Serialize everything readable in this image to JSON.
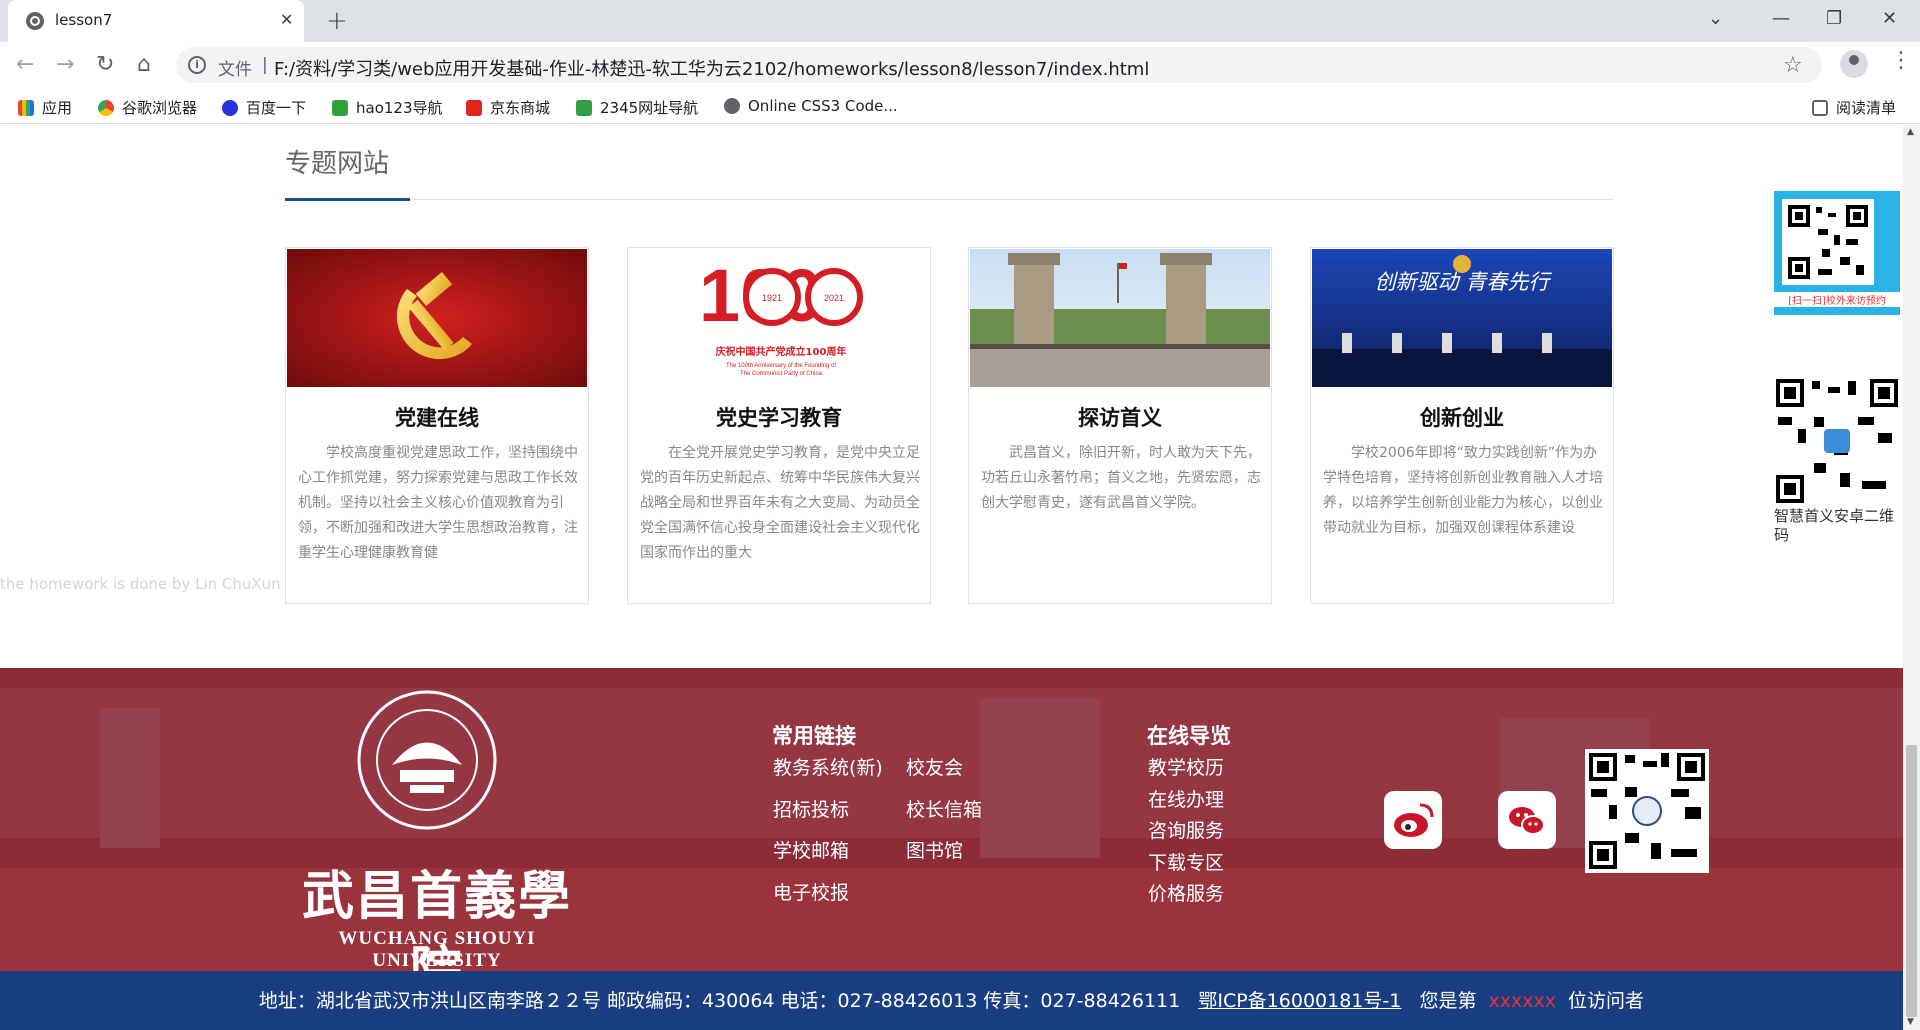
{
  "browser": {
    "tab_title": "lesson7",
    "address_prefix": "文件",
    "address_url": "F:/资料/学习类/web应用开发基础-作业-林楚迅-软工华为云2102/homeworks/lesson8/lesson7/index.html",
    "bookmarks": [
      {
        "label": "应用",
        "icon": "apps-grid-icon",
        "color": "#1a73e8"
      },
      {
        "label": "谷歌浏览器",
        "icon": "chrome-icon",
        "color": "#ea4335"
      },
      {
        "label": "百度一下",
        "icon": "baidu-paw-icon",
        "color": "#2932e1"
      },
      {
        "label": "hao123导航",
        "icon": "hao123-icon",
        "color": "#31a13a"
      },
      {
        "label": "京东商城",
        "icon": "jd-icon",
        "color": "#e1251b"
      },
      {
        "label": "2345网址导航",
        "icon": "2345-icon",
        "color": "#2f9e44"
      },
      {
        "label": "Online CSS3 Code...",
        "icon": "globe-icon",
        "color": "#5f6368"
      }
    ],
    "reading_list": "阅读清单"
  },
  "section": {
    "title": "专题网站"
  },
  "cards": [
    {
      "title": "党建在线",
      "text": "学校高度重视党建思政工作，坚持围绕中心工作抓党建，努力探索党建与思政工作长效机制。坚持以社会主义核心价值观教育为引领，不断加强和改进大学生思想政治教育，注重学生心理健康教育健",
      "image": "party-emblem-image"
    },
    {
      "title": "党史学习教育",
      "text": "在全党开展党史学习教育，是党中央立足党的百年历史新起点、统筹中华民族伟大复兴战略全局和世界百年未有之大变局、为动员全党全国满怀信心投身全面建设社会主义现代化国家而作出的重大",
      "image": "centenary-logo-image",
      "image_caption_cn": "庆祝中国共产党成立100周年",
      "image_caption_en1": "The 100th Anniversary of the Founding of",
      "image_caption_en2": "The Communist Party of China",
      "image_number": "100",
      "image_year_a": "1921",
      "image_year_b": "2021"
    },
    {
      "title": "探访首义",
      "text": "武昌首义，除旧开新，时人敢为天下先，功若丘山永著竹帛；首义之地，先贤宏愿，志创大学慰青史，遂有武昌首义学院。",
      "image": "campus-gate-photo"
    },
    {
      "title": "创新创业",
      "text": "学校2006年即将“致力实践创新”作为办学特色培育，坚持将创新创业教育融入人才培养，以培养学生创新创业能力为核心，以创业带动就业为目标，加强双创课程体系建设",
      "image": "innovation-forum-photo",
      "image_banner": "创新驱动 青春先行"
    }
  ],
  "homework_note": "the homework is done by Lin ChuXun",
  "side_qr": {
    "caption1": "[扫一扫]校外来访预约",
    "caption2": "智慧首义安卓二维码"
  },
  "footer": {
    "university_cn": "武昌首義學院",
    "university_en": "WUCHANG SHOUYI UNIVERSITY",
    "seal_text": "WUCHANG SHOUYI UNIVERSITY",
    "links_heading": "常用链接",
    "links": [
      "教务系统(新)",
      "校友会",
      "招标投标",
      "校长信箱",
      "学校邮箱",
      "图书馆",
      "电子校报"
    ],
    "nav_heading": "在线导览",
    "nav": [
      "教学校历",
      "在线办理",
      "咨询服务",
      "下载专区",
      "价格服务"
    ],
    "social": [
      "weibo-icon",
      "wechat-icon"
    ]
  },
  "footer_bar": {
    "address": "地址：湖北省武汉市洪山区南李路２２号 邮政编码：430064 电话：027-88426013 传真：027-88426111",
    "icp": "鄂ICP备16000181号-1",
    "visits_prefix": "您是第",
    "visits_value": "xxxxxx",
    "visits_suffix": "位访问者"
  },
  "colors": {
    "accent_blue": "#1a4f8b",
    "footer_red": "#8d2c39",
    "footer_bar_blue": "#1a3e82",
    "visits_red": "#e8303a"
  }
}
